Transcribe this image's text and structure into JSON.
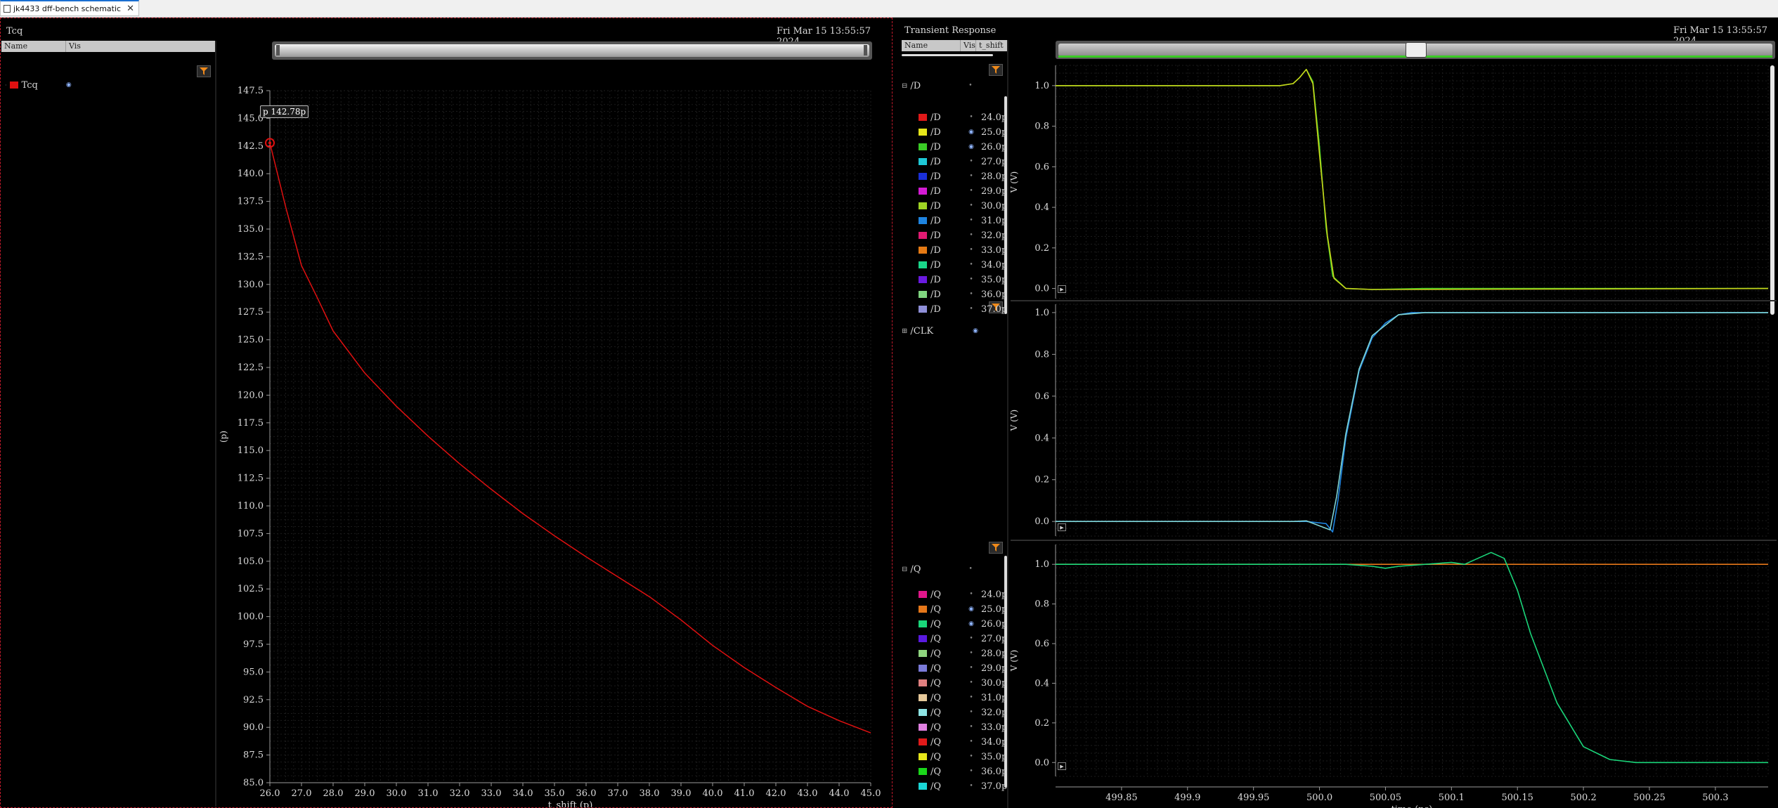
{
  "tab": {
    "title": "jk4433 dff-bench schematic",
    "close": "✕"
  },
  "left": {
    "title": "Tcq",
    "timestamp": "Fri Mar 15 13:55:57 2024",
    "cols": {
      "name": "Name",
      "vis": "Vis"
    },
    "signal": {
      "name": "Tcq",
      "color": "#e01010"
    },
    "marker_label": "p 142.78p"
  },
  "right": {
    "title": "Transient Response",
    "timestamp": "Fri Mar 15 13:55:57 2024",
    "cols": {
      "name": "Name",
      "vis": "Vis",
      "tshift": "t_shift"
    },
    "groupD": {
      "name": "/D"
    },
    "groupCLK": {
      "name": "/CLK"
    },
    "groupQ": {
      "name": "/Q"
    },
    "listD": [
      {
        "name": "/D",
        "val": "24.0p",
        "color": "#e01919",
        "vis": "dot"
      },
      {
        "name": "/D",
        "val": "25.0p",
        "color": "#e5e51a",
        "vis": "eye"
      },
      {
        "name": "/D",
        "val": "26.0p",
        "color": "#3acb26",
        "vis": "eye"
      },
      {
        "name": "/D",
        "val": "27.0p",
        "color": "#1ec8d6",
        "vis": "dot"
      },
      {
        "name": "/D",
        "val": "28.0p",
        "color": "#1a2fd8",
        "vis": "dot"
      },
      {
        "name": "/D",
        "val": "29.0p",
        "color": "#d41bd4",
        "vis": "dot"
      },
      {
        "name": "/D",
        "val": "30.0p",
        "color": "#9fd424",
        "vis": "dot"
      },
      {
        "name": "/D",
        "val": "31.0p",
        "color": "#1e84e0",
        "vis": "dot"
      },
      {
        "name": "/D",
        "val": "32.0p",
        "color": "#e01a72",
        "vis": "dot"
      },
      {
        "name": "/D",
        "val": "33.0p",
        "color": "#e57a14",
        "vis": "dot"
      },
      {
        "name": "/D",
        "val": "34.0p",
        "color": "#1ad68a",
        "vis": "dot"
      },
      {
        "name": "/D",
        "val": "35.0p",
        "color": "#6a1ae0",
        "vis": "dot"
      },
      {
        "name": "/D",
        "val": "36.0p",
        "color": "#7fd47f",
        "vis": "dot"
      },
      {
        "name": "/D",
        "val": "37.0p",
        "color": "#8f8fd8",
        "vis": "dot"
      }
    ],
    "listQ": [
      {
        "name": "/Q",
        "val": "24.0p",
        "color": "#e0168a",
        "vis": "dot"
      },
      {
        "name": "/Q",
        "val": "25.0p",
        "color": "#e5771a",
        "vis": "eye"
      },
      {
        "name": "/Q",
        "val": "26.0p",
        "color": "#1ad67a",
        "vis": "eye"
      },
      {
        "name": "/Q",
        "val": "27.0p",
        "color": "#5a1ae0",
        "vis": "dot"
      },
      {
        "name": "/Q",
        "val": "28.0p",
        "color": "#8fd47f",
        "vis": "dot"
      },
      {
        "name": "/Q",
        "val": "29.0p",
        "color": "#7a7ad8",
        "vis": "dot"
      },
      {
        "name": "/Q",
        "val": "30.0p",
        "color": "#e08080",
        "vis": "dot"
      },
      {
        "name": "/Q",
        "val": "31.0p",
        "color": "#e5c89a",
        "vis": "dot"
      },
      {
        "name": "/Q",
        "val": "32.0p",
        "color": "#8fe5e5",
        "vis": "dot"
      },
      {
        "name": "/Q",
        "val": "33.0p",
        "color": "#e080e0",
        "vis": "dot"
      },
      {
        "name": "/Q",
        "val": "34.0p",
        "color": "#e01a1a",
        "vis": "dot"
      },
      {
        "name": "/Q",
        "val": "35.0p",
        "color": "#e5e51a",
        "vis": "dot"
      },
      {
        "name": "/Q",
        "val": "36.0p",
        "color": "#1ad61a",
        "vis": "dot"
      },
      {
        "name": "/Q",
        "val": "37.0p",
        "color": "#1ad6d6",
        "vis": "dot"
      }
    ]
  },
  "chart_data": [
    {
      "type": "line",
      "id": "tcq",
      "xlabel": "t_shift (p)",
      "ylabel": "(p)",
      "xlim": [
        26.0,
        45.0
      ],
      "ylim": [
        85.0,
        147.5
      ],
      "xticks": [
        "26.0",
        "27.0",
        "28.0",
        "29.0",
        "30.0",
        "31.0",
        "32.0",
        "33.0",
        "34.0",
        "35.0",
        "36.0",
        "37.0",
        "38.0",
        "39.0",
        "40.0",
        "41.0",
        "42.0",
        "43.0",
        "44.0",
        "45.0"
      ],
      "yticks": [
        "85.0",
        "87.5",
        "90.0",
        "92.5",
        "95.0",
        "97.5",
        "100.0",
        "102.5",
        "105.0",
        "107.5",
        "110.0",
        "112.5",
        "115.0",
        "117.5",
        "120.0",
        "122.5",
        "125.0",
        "127.5",
        "130.0",
        "132.5",
        "135.0",
        "137.5",
        "140.0",
        "142.5",
        "145.0",
        "147.5"
      ],
      "series": [
        {
          "name": "Tcq",
          "color": "#e01010",
          "x": [
            26.0,
            26.5,
            27.0,
            27.5,
            28.0,
            29.0,
            30.0,
            31.0,
            32.0,
            33.0,
            34.0,
            35.0,
            36.0,
            37.0,
            38.0,
            39.0,
            40.0,
            41.0,
            42.0,
            43.0,
            44.0,
            45.0
          ],
          "y": [
            142.78,
            137.0,
            131.7,
            128.8,
            125.8,
            122.0,
            119.0,
            116.3,
            113.8,
            111.5,
            109.3,
            107.3,
            105.4,
            103.6,
            101.8,
            99.7,
            97.4,
            95.4,
            93.6,
            91.9,
            90.6,
            89.5
          ]
        }
      ]
    },
    {
      "type": "line",
      "id": "D",
      "ylabel": "V (V)",
      "xlim": [
        499.8,
        500.34
      ],
      "ylim": [
        -0.05,
        1.1
      ],
      "yticks": [
        "0.0",
        "0.2",
        "0.4",
        "0.6",
        "0.8",
        "1.0"
      ],
      "series": [
        {
          "color": "#3acb26",
          "x": [
            499.8,
            499.97,
            499.98,
            499.985,
            499.99,
            499.995,
            500.0,
            500.005,
            500.01,
            500.02,
            500.04,
            500.08,
            500.34
          ],
          "y": [
            1.0,
            1.0,
            1.01,
            1.04,
            1.08,
            1.02,
            0.7,
            0.3,
            0.06,
            0.0,
            -0.005,
            0.0,
            0.0
          ]
        },
        {
          "color": "#c8d41a",
          "x": [
            499.8,
            499.97,
            499.98,
            499.985,
            499.99,
            499.995,
            500.0,
            500.006,
            500.011,
            500.02,
            500.04,
            500.34
          ],
          "y": [
            1.0,
            1.0,
            1.01,
            1.04,
            1.08,
            1.01,
            0.66,
            0.26,
            0.05,
            0.0,
            -0.005,
            0.0
          ]
        }
      ]
    },
    {
      "type": "line",
      "id": "CLK",
      "ylabel": "V (V)",
      "xlim": [
        499.8,
        500.34
      ],
      "ylim": [
        -0.07,
        1.04
      ],
      "yticks": [
        "0.0",
        "0.2",
        "0.4",
        "0.6",
        "0.8",
        "1.0"
      ],
      "series": [
        {
          "color": "#1e84e0",
          "x": [
            499.8,
            499.99,
            500.005,
            500.01,
            500.014,
            500.02,
            500.03,
            500.04,
            500.05,
            500.06,
            500.07,
            500.08,
            500.1,
            500.34
          ],
          "y": [
            0.0,
            0.0,
            -0.01,
            -0.05,
            0.1,
            0.4,
            0.72,
            0.88,
            0.95,
            0.99,
            1.0,
            1.0,
            1.0,
            1.0
          ]
        },
        {
          "color": "#7fd4d4",
          "x": [
            499.8,
            499.98,
            499.99,
            500.008,
            500.013,
            500.02,
            500.03,
            500.04,
            500.06,
            500.08,
            500.34
          ],
          "y": [
            0.0,
            0.0,
            0.003,
            -0.04,
            0.12,
            0.42,
            0.73,
            0.89,
            0.99,
            1.0,
            1.0
          ]
        }
      ]
    },
    {
      "type": "line",
      "id": "Q",
      "xlabel": "time (ns)",
      "ylabel": "V (V)",
      "xlim": [
        499.8,
        500.34
      ],
      "ylim": [
        -0.07,
        1.1
      ],
      "xticks": [
        "499.85",
        "499.9",
        "499.95",
        "500.0",
        "500.05",
        "500.1",
        "500.15",
        "500.2",
        "500.25",
        "500.3"
      ],
      "yticks": [
        "0.0",
        "0.2",
        "0.4",
        "0.6",
        "0.8",
        "1.0"
      ],
      "series": [
        {
          "color": "#e5771a",
          "x": [
            499.8,
            500.34
          ],
          "y": [
            1.0,
            1.0
          ]
        },
        {
          "color": "#1ad67a",
          "x": [
            499.8,
            500.0,
            500.02,
            500.04,
            500.05,
            500.06,
            500.08,
            500.1,
            500.11,
            500.12,
            500.13,
            500.14,
            500.15,
            500.16,
            500.18,
            500.2,
            500.22,
            500.24,
            500.26,
            500.34
          ],
          "y": [
            1.0,
            1.0,
            1.0,
            0.99,
            0.98,
            0.99,
            1.0,
            1.01,
            1.0,
            1.03,
            1.06,
            1.03,
            0.87,
            0.65,
            0.3,
            0.08,
            0.015,
            0.0,
            0.0,
            0.0
          ]
        }
      ]
    }
  ]
}
